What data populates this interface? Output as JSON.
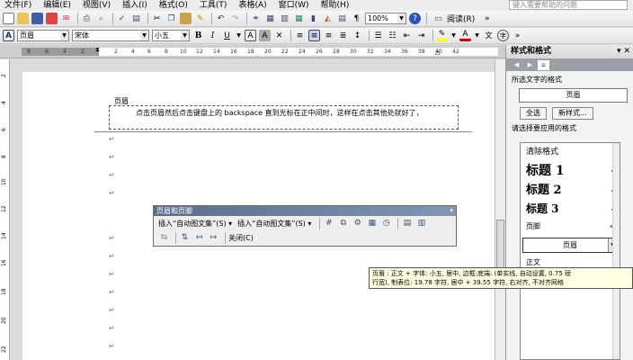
{
  "menu": {
    "items": [
      "文件(F)",
      "编辑(E)",
      "视图(V)",
      "插入(I)",
      "格式(O)",
      "工具(T)",
      "表格(A)",
      "窗口(W)",
      "帮助(H)"
    ],
    "help_placeholder": "键入需要帮助的问题"
  },
  "standard_toolbar": {
    "zoom_value": "100%",
    "read_label": "阅读(R)"
  },
  "format_toolbar": {
    "style_value": "页眉",
    "font_value": "宋体",
    "size_value": "小五"
  },
  "ruler": {
    "ticks": [
      "8",
      "6",
      "4",
      "2",
      "2",
      "4",
      "6",
      "8",
      "10",
      "12",
      "14",
      "16",
      "18",
      "20",
      "22",
      "24",
      "26",
      "28",
      "30",
      "32",
      "34",
      "36",
      "38",
      "40",
      "42"
    ]
  },
  "vruler": {
    "ticks": [
      "2",
      "4",
      "6",
      "8",
      "10",
      "12",
      "14",
      "16",
      "18",
      "20",
      "22"
    ]
  },
  "document": {
    "header_label": "页眉",
    "header_text": "点击页眉然后点击键盘上的 backspace 直到光标在正中间时，这样在点击其他处就好了，",
    "para_mark": "↵"
  },
  "hf_toolbar": {
    "title": "页眉和页脚",
    "insert_autotext_1": "插入“自动图文集”(S) ▾",
    "insert_autotext_2": "插入“自动图文集”(S) ▾",
    "close": "关闭(C)"
  },
  "side_pane": {
    "title": "样式和格式",
    "selected_label": "所选文字的格式",
    "selected_value": "页眉",
    "select_all": "全选",
    "new_style": "新样式...",
    "apply_label": "请选择要应用的格式",
    "list": {
      "clear": "清除格式",
      "h1": "标题 1",
      "h2": "标题 2",
      "h3": "标题 3",
      "footer": "页脚",
      "header_sel": "页眉",
      "body": "正文"
    }
  },
  "tooltip": {
    "line1": "页眉 : 正文 + 字体: 小五, 居中, 边框:底端: (单实线, 自动设置, 0.75 磅",
    "line2": "行宽), 制表位: 19.78 字符, 居中 + 39.55 字符, 右对齐, 不对齐网格"
  }
}
